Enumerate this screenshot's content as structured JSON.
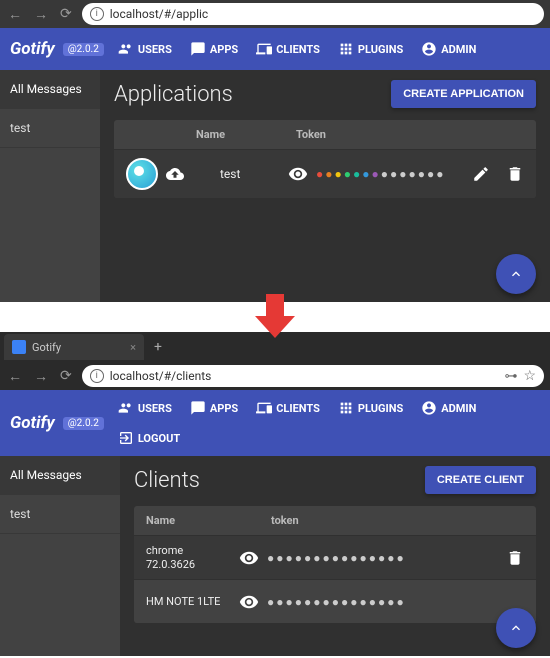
{
  "top": {
    "url": "localhost/#/applic",
    "brand": "Gotify",
    "version": "@2.0.2",
    "nav": {
      "users": "USERS",
      "apps": "APPS",
      "clients": "CLIENTS",
      "plugins": "PLUGINS",
      "admin": "ADMIN"
    },
    "sidebar": [
      "All Messages",
      "test"
    ],
    "page_title": "Applications",
    "create_label": "CREATE APPLICATION",
    "columns": {
      "name": "Name",
      "token": "Token"
    },
    "rows": [
      {
        "name": "test"
      }
    ]
  },
  "bottom": {
    "tab_title": "Gotify",
    "url": "localhost/#/clients",
    "brand": "Gotify",
    "version": "@2.0.2",
    "nav": {
      "users": "USERS",
      "apps": "APPS",
      "clients": "CLIENTS",
      "plugins": "PLUGINS",
      "admin": "ADMIN",
      "logout": "LOGOUT"
    },
    "sidebar": [
      "All Messages",
      "test"
    ],
    "page_title": "Clients",
    "create_label": "CREATE CLIENT",
    "columns": {
      "name": "Name",
      "token": "token"
    },
    "rows": [
      {
        "name": "chrome 72.0.3626"
      },
      {
        "name": "HM NOTE 1LTE"
      }
    ]
  }
}
